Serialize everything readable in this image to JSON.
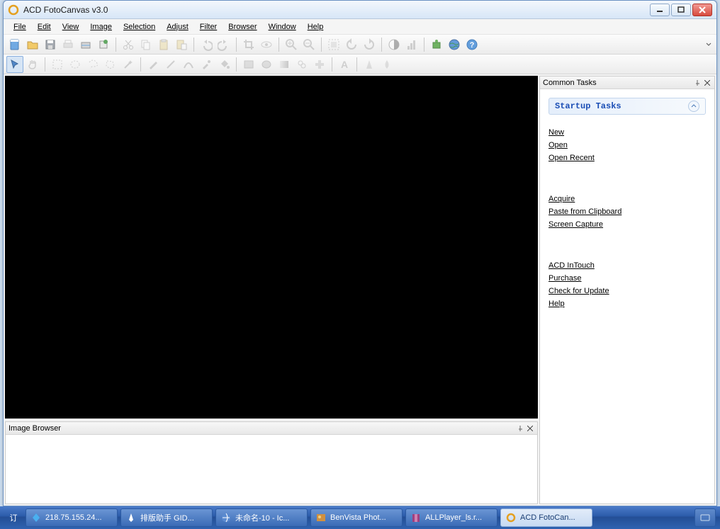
{
  "titlebar": {
    "title": "ACD FotoCanvas v3.0"
  },
  "menus": [
    "File",
    "Edit",
    "View",
    "Image",
    "Selection",
    "Adjust",
    "Filter",
    "Browser",
    "Window",
    "Help"
  ],
  "panels": {
    "common_tasks": {
      "title": "Common Tasks"
    },
    "startup_tasks": {
      "title": "Startup Tasks"
    },
    "image_browser": {
      "title": "Image Browser"
    }
  },
  "tasks": {
    "group1": [
      "New",
      "Open",
      "Open Recent"
    ],
    "group2": [
      "Acquire",
      "Paste from Clipboard",
      "Screen Capture"
    ],
    "group3": [
      "ACD InTouch",
      "Purchase",
      "Check for Update",
      "Help"
    ]
  },
  "taskbar": {
    "pre": "订",
    "items": [
      {
        "label": "218.75.155.24..."
      },
      {
        "label": "排版助手 GID..."
      },
      {
        "label": "未命名-10 - Ic..."
      },
      {
        "label": "BenVista Phot..."
      },
      {
        "label": "ALLPlayer_ls.r..."
      },
      {
        "label": "ACD FotoCan..."
      }
    ]
  }
}
